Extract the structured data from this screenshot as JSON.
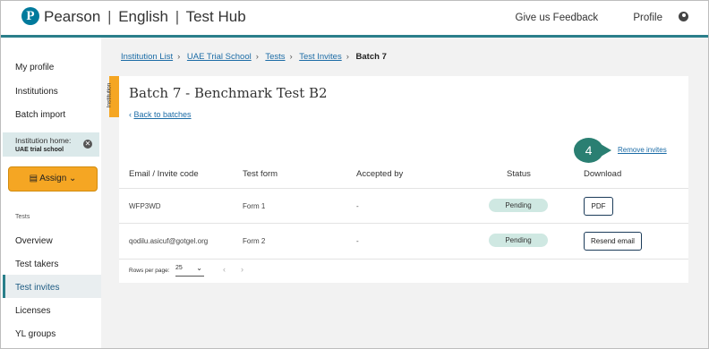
{
  "header": {
    "logo_letter": "P",
    "brand_pearson": "Pearson",
    "brand_english": "English",
    "brand_hub": "Test Hub",
    "separator": "|",
    "feedback": "Give us Feedback",
    "profile": "Profile"
  },
  "sidebar": {
    "my_profile": "My profile",
    "institutions": "Institutions",
    "batch_import": "Batch import",
    "institution_home_label": "Institution home:",
    "institution_home_value": "UAE trial school",
    "assign": "Assign",
    "tests_section": "Tests",
    "overview": "Overview",
    "test_takers": "Test takers",
    "test_invites": "Test invites",
    "licenses": "Licenses",
    "yl_groups": "YL groups"
  },
  "breadcrumb": {
    "items": [
      "Institution List",
      "UAE Trial School",
      "Tests",
      "Test Invites"
    ],
    "current": "Batch 7"
  },
  "page": {
    "side_tab": "Institution",
    "title": "Batch 7 - Benchmark Test B2",
    "back": "Back to batches",
    "remove_invites": "Remove invites",
    "step_number": "4"
  },
  "table": {
    "columns": [
      "Email / Invite code",
      "Test form",
      "Accepted by",
      "Status",
      "Download"
    ],
    "rows": [
      {
        "code": "WFP3WD",
        "form": "Form 1",
        "accepted": "-",
        "status": "Pending",
        "action": "PDF"
      },
      {
        "code": "qodilu.asicuf@gotgel.org",
        "form": "Form 2",
        "accepted": "-",
        "status": "Pending",
        "action": "Resend email"
      }
    ]
  },
  "pagination": {
    "rows_per_page_label": "Rows per page:",
    "rows_per_page_value": "25",
    "prev": "‹",
    "next": "›"
  },
  "colors": {
    "accent": "#2a7f8a",
    "assign": "#f5a623",
    "link": "#1c6ca6",
    "pending": "#cfe8e2"
  }
}
